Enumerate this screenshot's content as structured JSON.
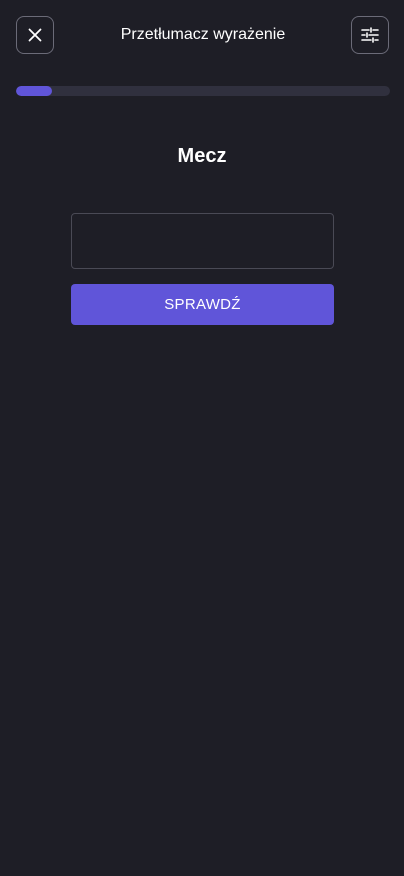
{
  "header": {
    "title": "Przetłumacz wyrażenie",
    "close_icon": "close-icon",
    "settings_icon": "sliders-icon"
  },
  "progress": {
    "fraction": 0.096,
    "track_color": "#30303e",
    "fill_color": "#6055d9"
  },
  "exercise": {
    "word": "Mecz",
    "answer_value": "",
    "answer_placeholder": ""
  },
  "actions": {
    "check_label": "SPRAWDŹ"
  },
  "colors": {
    "background": "#1e1e26",
    "accent": "#6055d9"
  }
}
